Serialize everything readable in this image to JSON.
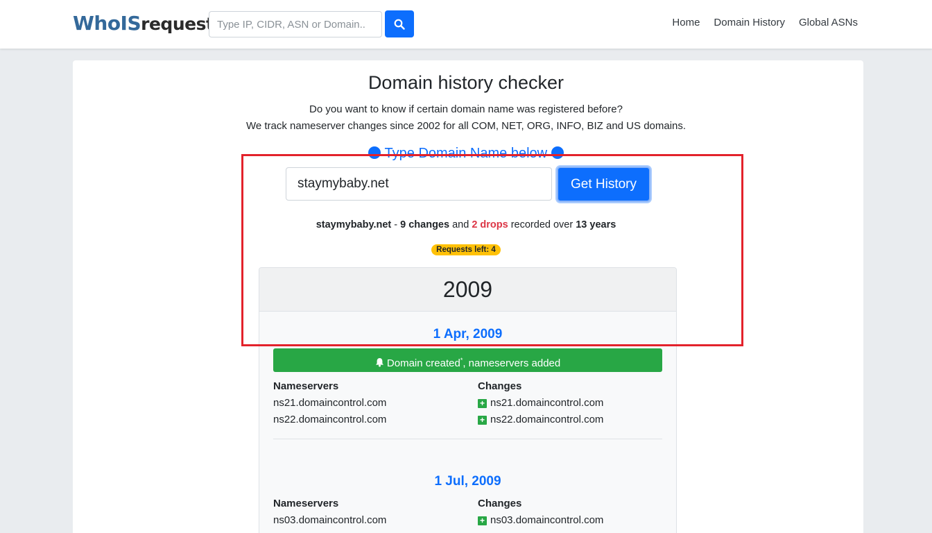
{
  "navbar": {
    "logo_part1": "WhoIS",
    "logo_part2": "request",
    "search_placeholder": "Type IP, CIDR, ASN or Domain..",
    "links": [
      "Home",
      "Domain History",
      "Global ASNs"
    ]
  },
  "main": {
    "title": "Domain history checker",
    "lead_line1": "Do you want to know if certain domain name was registered before?",
    "lead_line2": "We track nameserver changes since 2002 for all COM, NET, ORG, INFO, BIZ and US domains.",
    "hint": "Type Domain Name below",
    "domain_value": "staymybaby.net",
    "get_button": "Get History",
    "summary": {
      "domain": "staymybaby.net",
      "sep": " - ",
      "changes": "9 changes",
      "and": " and ",
      "drops": "2 drops",
      "recorded": " recorded over ",
      "years": "13 years"
    },
    "requests_left": "Requests left: 4"
  },
  "history": {
    "year": "2009",
    "ns_header": "Nameservers",
    "changes_header": "Changes",
    "entries": [
      {
        "date": "1 Apr, 2009",
        "event": "Domain created",
        "event_sup": "*",
        "event_suffix": ", nameservers added",
        "nameservers": [
          "ns21.domaincontrol.com",
          "ns22.domaincontrol.com"
        ],
        "changes": [
          "ns21.domaincontrol.com",
          "ns22.domaincontrol.com"
        ]
      },
      {
        "date": "1 Jul, 2009",
        "nameservers": [
          "ns03.domaincontrol.com"
        ],
        "changes": [
          "ns03.domaincontrol.com"
        ]
      }
    ]
  },
  "colors": {
    "primary": "#0d6efd",
    "success": "#28a745",
    "danger": "#dc3545",
    "warning": "#ffc107",
    "highlight": "#e3222b"
  }
}
